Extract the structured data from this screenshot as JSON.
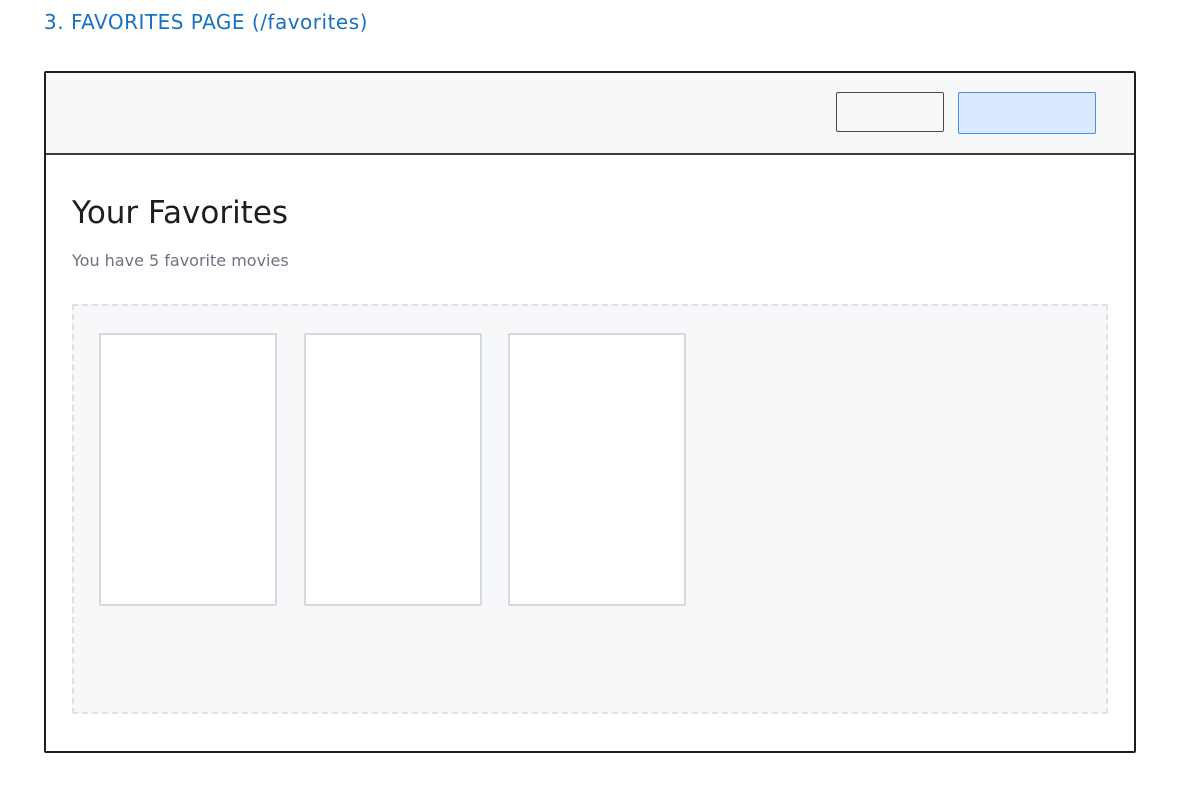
{
  "section": {
    "title": "3. FAVORITES PAGE (/favorites)"
  },
  "colors": {
    "title_accent": "#1971c2",
    "primary_button_fill": "#dbe9ff",
    "primary_button_border": "#4a8ff0",
    "frame_stroke": "#1e1e1e",
    "area_fill": "#f7f8fa"
  },
  "page": {
    "heading": "Your Favorites",
    "subtitle": "You have 5 favorite movies"
  },
  "favorites": {
    "visible_card_count": 3
  }
}
